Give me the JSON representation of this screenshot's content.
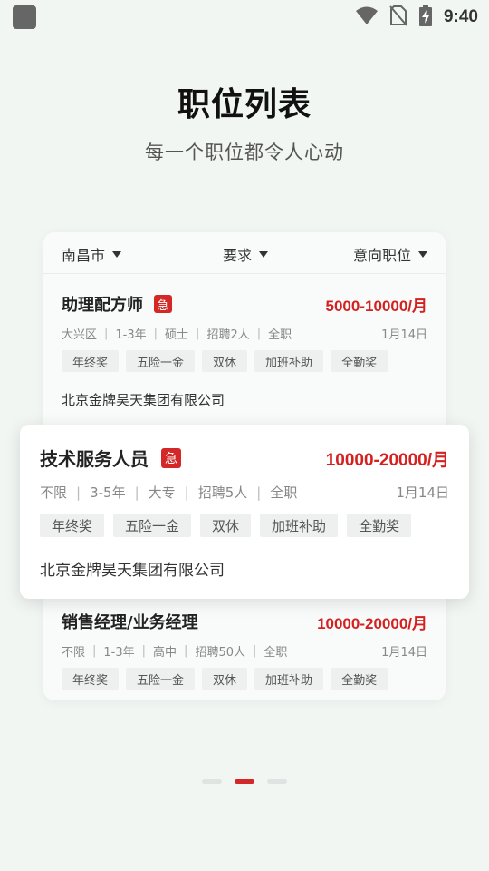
{
  "status_bar": {
    "time": "9:40"
  },
  "header": {
    "title": "职位列表",
    "subtitle": "每一个职位都令人心动"
  },
  "filters": {
    "city": "南昌市",
    "requirement": "要求",
    "position": "意向职位"
  },
  "jobs": [
    {
      "title": "助理配方师",
      "urgent_label": "急",
      "salary": "5000-10000/月",
      "district": "大兴区",
      "experience": "1-3年",
      "education": "硕士",
      "hiring": "招聘2人",
      "type": "全职",
      "date": "1月14日",
      "tags": [
        "年终奖",
        "五险一金",
        "双休",
        "加班补助",
        "全勤奖"
      ],
      "company": "北京金牌昊天集团有限公司"
    },
    {
      "title": "技术服务人员",
      "urgent_label": "急",
      "salary": "10000-20000/月",
      "district": "不限",
      "experience": "3-5年",
      "education": "大专",
      "hiring": "招聘5人",
      "type": "全职",
      "date": "1月14日",
      "tags": [
        "年终奖",
        "五险一金",
        "双休",
        "加班补助",
        "全勤奖"
      ],
      "company": "北京金牌昊天集团有限公司"
    },
    {
      "title": "销售经理/业务经理",
      "salary": "10000-20000/月",
      "district": "不限",
      "experience": "1-3年",
      "education": "高中",
      "hiring": "招聘50人",
      "type": "全职",
      "date": "1月14日",
      "tags": [
        "年终奖",
        "五险一金",
        "双休",
        "加班补助",
        "全勤奖"
      ]
    }
  ],
  "colors": {
    "accent": "#d42828",
    "background": "#f1f6f3"
  },
  "icons": [
    "app-icon",
    "wifi-icon",
    "no-sim-icon",
    "battery-charging-icon"
  ]
}
